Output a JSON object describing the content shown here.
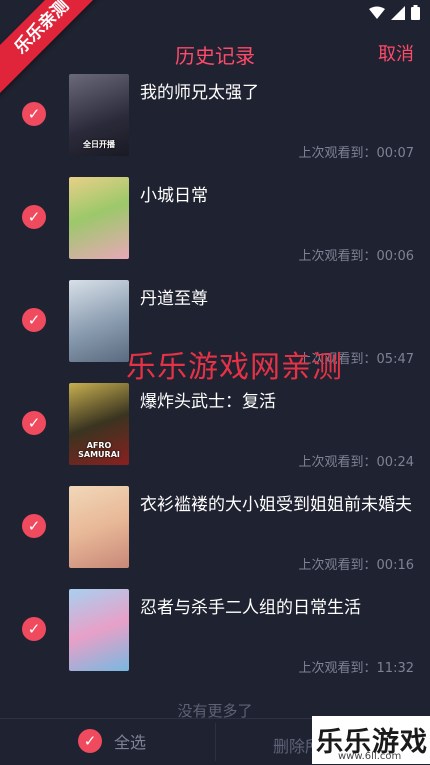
{
  "status_bar": {
    "icons": [
      "wifi-icon",
      "signal-icon",
      "battery-icon"
    ]
  },
  "header": {
    "title": "历史记录",
    "cancel_label": "取消"
  },
  "items": [
    {
      "name": "我的师兄太强了",
      "time": "上次观看到：00:07",
      "thumb_text": "全日开播",
      "thumb_color": "#3b3a4a"
    },
    {
      "name": "小城日常",
      "time": "上次观看到：00:06",
      "thumb_text": "",
      "thumb_color": "#c9d88a"
    },
    {
      "name": "丹道至尊",
      "time": "上次观看到：05:47",
      "thumb_text": "",
      "thumb_color": "#a9b8c8"
    },
    {
      "name": "爆炸头武士：复活",
      "time": "上次观看到：00:24",
      "thumb_text": "AFRO SAMURAI",
      "thumb_color": "#4a4226"
    },
    {
      "name": "衣衫褴褛的大小姐受到姐姐前未婚夫",
      "time": "上次观看到：00:16",
      "thumb_text": "",
      "thumb_color": "#e8c9a8"
    },
    {
      "name": "忍者与杀手二人组的日常生活",
      "time": "上次观看到：11:32",
      "thumb_text": "",
      "thumb_color": "#8fb8e0"
    }
  ],
  "footer": {
    "no_more": "没有更多了",
    "select_all": "全选",
    "delete_all": "删除所"
  },
  "watermarks": {
    "ribbon": "乐乐亲测",
    "center": "乐乐游戏网亲测",
    "logo_text": "乐乐游戏",
    "logo_url": "www.6ll.com"
  },
  "colors": {
    "accent": "#ff4a6a",
    "check": "#ef4a5e",
    "background": "#1f2230"
  }
}
